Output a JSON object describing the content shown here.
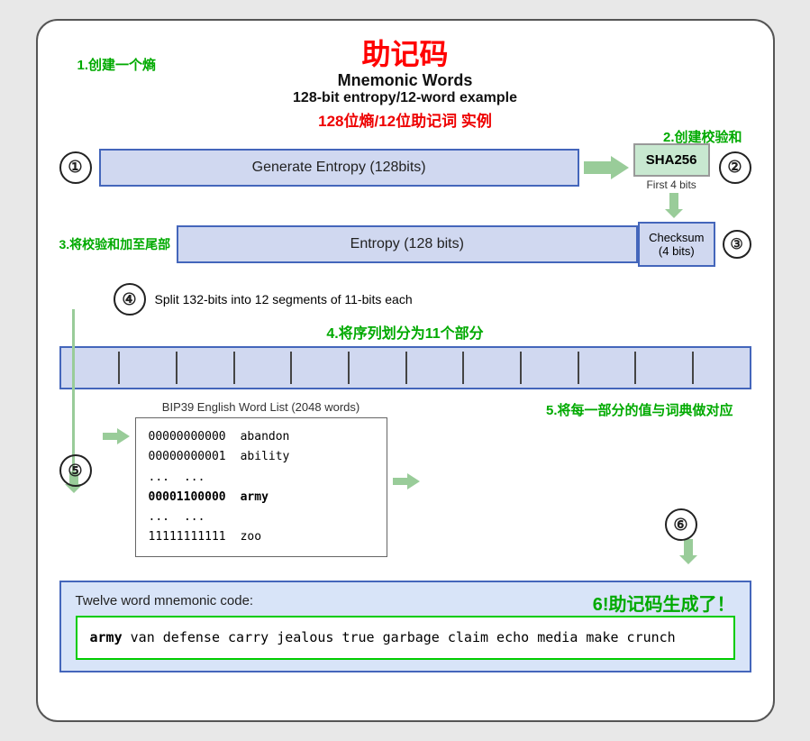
{
  "title": {
    "cn": "助记码",
    "en1": "Mnemonic Words",
    "en2": "128-bit entropy/12-word example",
    "cn2": "128位熵/12位助记词 实例"
  },
  "labels": {
    "label1": "1.创建一个熵",
    "label2": "2.创建校验和",
    "label3": "3.将校验和加至尾部",
    "label4": "4.将序列划分为11个部分",
    "label5": "5.将每一部分的值与词典做对应",
    "label6": "6!助记码生成了！"
  },
  "step1": {
    "circle": "①",
    "box": "Generate Entropy (128bits)"
  },
  "step2": {
    "circle": "②",
    "sha": "SHA256",
    "sublabel": "First 4 bits"
  },
  "step3": {
    "label3_text": "3.将校验和加至尾部",
    "entropy": "Entropy (128 bits)",
    "checksum": "Checksum\n(4 bits)",
    "circle": "③"
  },
  "step4": {
    "circle": "④",
    "text": "Split 132-bits into 12 segments of 11-bits each",
    "label": "4.将序列划分为11个部分",
    "segments": 12
  },
  "bip39": {
    "title": "BIP39 English Word List (2048 words)",
    "rows": [
      {
        "bits": "00000000000",
        "word": "abandon"
      },
      {
        "bits": "00000000001",
        "word": "ability"
      },
      {
        "bits": "...",
        "word": "..."
      },
      {
        "bits": "00001100000",
        "word": "army",
        "highlight": true
      },
      {
        "bits": "...",
        "word": "..."
      },
      {
        "bits": "11111111111",
        "word": "zoo"
      }
    ]
  },
  "step5": {
    "circle": "⑤"
  },
  "step6": {
    "circle": "⑥"
  },
  "output": {
    "title": "Twelve word mnemonic code:",
    "label6": "6!助记码生成了！",
    "mnemonic_bold": "army",
    "mnemonic_rest": " van defense carry jealous true\ngarbage claim echo media make crunch"
  }
}
